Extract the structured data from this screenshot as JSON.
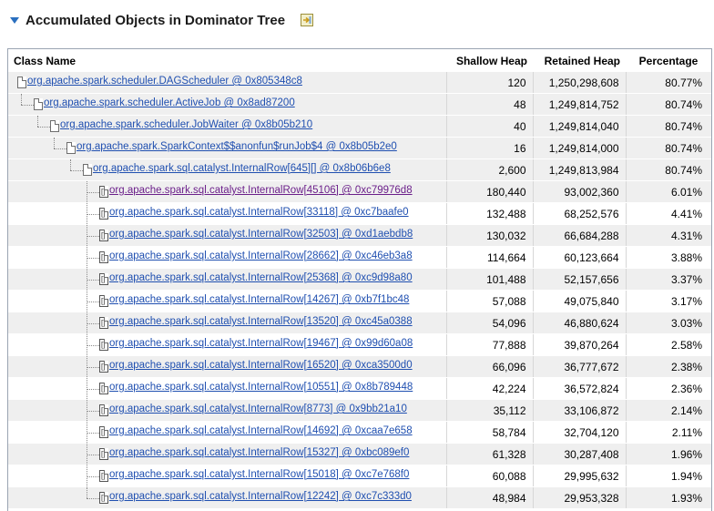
{
  "section": {
    "title": "Accumulated Objects in Dominator Tree"
  },
  "table": {
    "columns": {
      "class_name": "Class Name",
      "shallow": "Shallow Heap",
      "retained": "Retained Heap",
      "percentage": "Percentage"
    },
    "rows": [
      {
        "name": "org.apache.spark.scheduler.DAGScheduler @ 0x805348c8",
        "shallow": "120",
        "retained": "1,250,298,608",
        "percentage": "80.77%"
      },
      {
        "name": "org.apache.spark.scheduler.ActiveJob @ 0x8ad87200",
        "shallow": "48",
        "retained": "1,249,814,752",
        "percentage": "80.74%"
      },
      {
        "name": "org.apache.spark.scheduler.JobWaiter @ 0x8b05b210",
        "shallow": "40",
        "retained": "1,249,814,040",
        "percentage": "80.74%"
      },
      {
        "name": "org.apache.spark.SparkContext$$anonfun$runJob$4 @ 0x8b05b2e0",
        "shallow": "16",
        "retained": "1,249,814,000",
        "percentage": "80.74%"
      },
      {
        "name": "org.apache.spark.sql.catalyst.InternalRow[645][] @ 0x8b06b6e8",
        "shallow": "2,600",
        "retained": "1,249,813,984",
        "percentage": "80.74%"
      },
      {
        "name": "org.apache.spark.sql.catalyst.InternalRow[45106] @ 0xc79976d8",
        "shallow": "180,440",
        "retained": "93,002,360",
        "percentage": "6.01%"
      },
      {
        "name": "org.apache.spark.sql.catalyst.InternalRow[33118] @ 0xc7baafe0",
        "shallow": "132,488",
        "retained": "68,252,576",
        "percentage": "4.41%"
      },
      {
        "name": "org.apache.spark.sql.catalyst.InternalRow[32503] @ 0xd1aebdb8",
        "shallow": "130,032",
        "retained": "66,684,288",
        "percentage": "4.31%"
      },
      {
        "name": "org.apache.spark.sql.catalyst.InternalRow[28662] @ 0xc46eb3a8",
        "shallow": "114,664",
        "retained": "60,123,664",
        "percentage": "3.88%"
      },
      {
        "name": "org.apache.spark.sql.catalyst.InternalRow[25368] @ 0xc9d98a80",
        "shallow": "101,488",
        "retained": "52,157,656",
        "percentage": "3.37%"
      },
      {
        "name": "org.apache.spark.sql.catalyst.InternalRow[14267] @ 0xb7f1bc48",
        "shallow": "57,088",
        "retained": "49,075,840",
        "percentage": "3.17%"
      },
      {
        "name": "org.apache.spark.sql.catalyst.InternalRow[13520] @ 0xc45a0388",
        "shallow": "54,096",
        "retained": "46,880,624",
        "percentage": "3.03%"
      },
      {
        "name": "org.apache.spark.sql.catalyst.InternalRow[19467] @ 0x99d60a08",
        "shallow": "77,888",
        "retained": "39,870,264",
        "percentage": "2.58%"
      },
      {
        "name": "org.apache.spark.sql.catalyst.InternalRow[16520] @ 0xca3500d0",
        "shallow": "66,096",
        "retained": "36,777,672",
        "percentage": "2.38%"
      },
      {
        "name": "org.apache.spark.sql.catalyst.InternalRow[10551] @ 0x8b789448",
        "shallow": "42,224",
        "retained": "36,572,824",
        "percentage": "2.36%"
      },
      {
        "name": "org.apache.spark.sql.catalyst.InternalRow[8773] @ 0x9bb21a10",
        "shallow": "35,112",
        "retained": "33,106,872",
        "percentage": "2.14%"
      },
      {
        "name": "org.apache.spark.sql.catalyst.InternalRow[14692] @ 0xcaa7e658",
        "shallow": "58,784",
        "retained": "32,704,120",
        "percentage": "2.11%"
      },
      {
        "name": "org.apache.spark.sql.catalyst.InternalRow[15327] @ 0xbc089ef0",
        "shallow": "61,328",
        "retained": "30,287,408",
        "percentage": "1.96%"
      },
      {
        "name": "org.apache.spark.sql.catalyst.InternalRow[15018] @ 0xc7e768f0",
        "shallow": "60,088",
        "retained": "29,995,632",
        "percentage": "1.94%"
      },
      {
        "name": "org.apache.spark.sql.catalyst.InternalRow[12242] @ 0xc7c333d0",
        "shallow": "48,984",
        "retained": "29,953,328",
        "percentage": "1.93%"
      }
    ]
  }
}
